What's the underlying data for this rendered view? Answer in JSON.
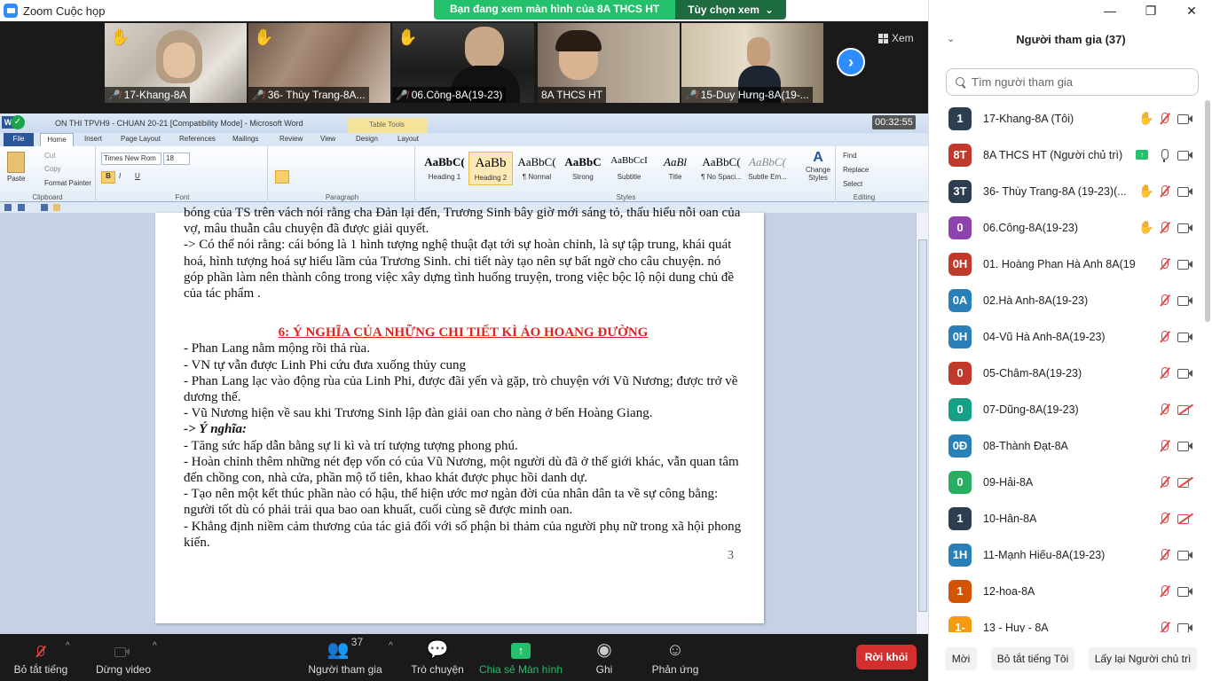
{
  "window": {
    "title": "Zoom Cuộc họp"
  },
  "share_banner": {
    "message": "Bạn đang xem màn hình của 8A THCS HT",
    "options_label": "Tùy chọn xem"
  },
  "view_button": {
    "label": "Xem"
  },
  "thumbnails": [
    {
      "name": "17-Khang-8A",
      "hand": "✋"
    },
    {
      "name": "36- Thùy Trang-8A...",
      "hand": "✋"
    },
    {
      "name": "06.Công-8A(19-23)",
      "hand": "✋"
    },
    {
      "name": "8A THCS HT",
      "hand": ""
    },
    {
      "name": "15-Duy Hưng-8A(19-...",
      "hand": ""
    }
  ],
  "word": {
    "doc_title": "ON THI TPVH9 - CHUAN 20-21 [Compatibility Mode] - Microsoft Word",
    "table_tools": "Table Tools",
    "timer": "00:32:55",
    "tabs": [
      "File",
      "Home",
      "Insert",
      "Page Layout",
      "References",
      "Mailings",
      "Review",
      "View",
      "Design",
      "Layout"
    ],
    "clipboard": {
      "paste": "Paste",
      "cut": "Cut",
      "copy": "Copy",
      "format_painter": "Format Painter",
      "group": "Clipboard"
    },
    "font": {
      "name": "Times New Rom",
      "size": "18",
      "group": "Font"
    },
    "paragraph": {
      "group": "Paragraph"
    },
    "styles": {
      "group": "Styles",
      "items": [
        {
          "preview": "AaBbC(",
          "name": "Heading 1"
        },
        {
          "preview": "AaBb",
          "name": "Heading 2"
        },
        {
          "preview": "AaBbC(",
          "name": "¶ Normal"
        },
        {
          "preview": "AaBbC",
          "name": "Strong"
        },
        {
          "preview": "AaBbCcI",
          "name": "Subtitle"
        },
        {
          "preview": "AaBl",
          "name": "Title"
        },
        {
          "preview": "AaBbC(",
          "name": "¶ No Spaci..."
        },
        {
          "preview": "AaBbC(",
          "name": "Subtle Em..."
        }
      ],
      "change_styles": "Change Styles"
    },
    "editing": {
      "find": "Find",
      "replace": "Replace",
      "select": "Select",
      "group": "Editing"
    },
    "page_number": "3",
    "paragraphs_before": [
      "bóng của TS  trên vách nói rằng cha Đản lại đến, Trương Sinh bây giờ mới sáng tỏ, thấu hiểu nỗi oan của vợ, mâu thuẫn câu chuyện đã được giải quyết.",
      "-> Có thể nói rằng: cái bóng là 1 hình tượng nghệ thuật đạt tới sự hoàn chỉnh, là sự tập trung, khái quát hoá, hình tượng hoá sự hiểu lầm của Trương Sinh. chi tiết này tạo nên sự bất ngờ cho câu chuyện. nó góp phần làm nên thành công trong việc xây dựng tình huống truyện,  trong việc bộc lộ nội dung chủ đề của tác phẩm ."
    ],
    "heading": "6: Ý NGHĨA CỦA NHỮNG CHI TIẾT KÌ ẢO HOANG ĐƯỜNG",
    "paragraphs_after": [
      "- Phan Lang nằm mộng rồi thả rùa.",
      "- VN tự vẫn được Linh Phi cứu đưa xuống thủy cung",
      "- Phan Lang lạc vào động rùa của Linh Phi, được đãi yến và gặp, trò chuyện với Vũ Nương; được trở về dương thế.",
      "- Vũ Nương hiện về sau khi Trương Sinh lập đàn giải oan cho nàng ở bến Hoàng Giang."
    ],
    "meaning_label": "-> Ý nghĩa:",
    "meaning_items": [
      "- Tăng sức hấp dẫn bằng sự li kì và trí tượng tượng phong phú.",
      "- Hoàn chỉnh thêm những nét đẹp vốn có của Vũ Nương, một người dù đã ở thế giới khác, vẫn quan tâm đến chồng con, nhà cửa, phần mộ tổ tiên, khao khát được phục hồi danh dự.",
      "- Tạo nên một kết thúc phần nào có hậu, thể hiện ước mơ ngàn đời của nhân dân ta về sự công bằng: người tốt dù có phải trải qua bao oan khuất, cuối cùng sẽ được minh oan.",
      "- Khẳng định niềm cảm thương của tác giả đối với số phận bi thảm của người phụ nữ trong xã hội phong kiến."
    ]
  },
  "toolbar": {
    "mute": "Bỏ tắt tiếng",
    "video": "Dừng video",
    "participants": "Người tham gia",
    "participants_count": "37",
    "chat": "Trò chuyện",
    "share": "Chia sẻ Màn hình",
    "record": "Ghi",
    "reactions": "Phản ứng",
    "leave": "Rời khỏi"
  },
  "panel": {
    "title": "Người tham gia (37)",
    "search_placeholder": "Tìm người tham gia",
    "invite": "Mời",
    "unmute_me": "Bỏ tắt tiếng Tôi",
    "reclaim_host": "Lấy lại Người chủ trì",
    "participants": [
      {
        "initials": "1",
        "color": "#2d3e50",
        "name": "17-Khang-8A (Tôi)",
        "hand": true,
        "mic": "off",
        "cam": "on"
      },
      {
        "initials": "8T",
        "color": "#c0392b",
        "name": "8A THCS HT (Người chủ trì)",
        "sharing": true,
        "mic": "on",
        "cam": "on"
      },
      {
        "initials": "3T",
        "color": "#2d3e50",
        "name": "36- Thùy Trang-8A (19-23)(...",
        "hand": true,
        "mic": "off",
        "cam": "on"
      },
      {
        "initials": "0",
        "color": "#8e44ad",
        "name": "06.Công-8A(19-23)",
        "hand": true,
        "mic": "off",
        "cam": "on"
      },
      {
        "initials": "0H",
        "color": "#c0392b",
        "name": "01. Hoàng Phan Hà Anh 8A(19-...",
        "mic": "off",
        "cam": "on"
      },
      {
        "initials": "0A",
        "color": "#2980b9",
        "name": "02.Hà Anh-8A(19-23)",
        "mic": "off",
        "cam": "on"
      },
      {
        "initials": "0H",
        "color": "#2980b9",
        "name": "04-Vũ Hà Anh-8A(19-23)",
        "mic": "off",
        "cam": "on"
      },
      {
        "initials": "0",
        "color": "#c0392b",
        "name": "05-Châm-8A(19-23)",
        "mic": "off",
        "cam": "on"
      },
      {
        "initials": "0",
        "color": "#16a085",
        "name": "07-Dũng-8A(19-23)",
        "mic": "off",
        "cam": "off"
      },
      {
        "initials": "0Đ",
        "color": "#2980b9",
        "name": "08-Thành Đạt-8A",
        "mic": "off",
        "cam": "on"
      },
      {
        "initials": "0",
        "color": "#27ae60",
        "name": "09-Hải-8A",
        "mic": "off",
        "cam": "off"
      },
      {
        "initials": "1",
        "color": "#2d3e50",
        "name": "10-Hân-8A",
        "mic": "off",
        "cam": "off"
      },
      {
        "initials": "1H",
        "color": "#2980b9",
        "name": "11-Mạnh Hiếu-8A(19-23)",
        "mic": "off",
        "cam": "on"
      },
      {
        "initials": "1",
        "color": "#d35400",
        "name": "12-hoa-8A",
        "mic": "off",
        "cam": "on"
      },
      {
        "initials": "1-",
        "color": "#f39c12",
        "name": "13 - Huy - 8A",
        "mic": "off",
        "cam": "on"
      }
    ]
  },
  "colors": {
    "zoom_blue": "#2d8cff",
    "share_green": "#23c16b",
    "leave_red": "#d32f2f",
    "word_heading_red": "#dd2222"
  }
}
